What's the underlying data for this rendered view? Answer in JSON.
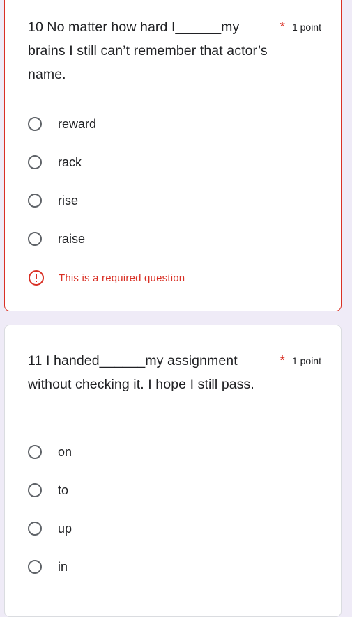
{
  "questions": [
    {
      "title": "10 No matter how hard I______my brains I still can’t remember that actor’s name.",
      "required_marker": "*",
      "points": "1 point",
      "options": [
        "reward",
        "rack",
        "rise",
        "raise"
      ],
      "error": "This is a required question"
    },
    {
      "title": "11 I handed______my assignment without checking it. I hope I still pass.",
      "required_marker": "*",
      "points": "1 point",
      "options": [
        "on",
        "to",
        "up",
        "in"
      ]
    }
  ],
  "colors": {
    "background": "#efebf7",
    "error": "#d93025",
    "radio_border": "#5f6368"
  },
  "icons": {
    "error": "error-exclamation-icon"
  }
}
